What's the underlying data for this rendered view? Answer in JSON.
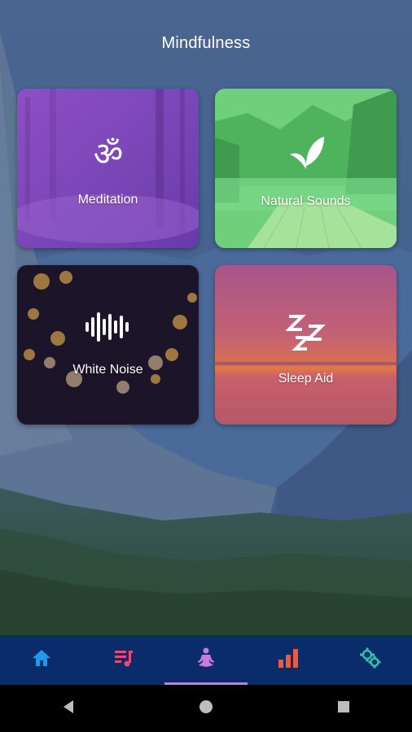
{
  "header": {
    "title": "Mindfulness"
  },
  "cards": {
    "meditation": {
      "label": "Meditation",
      "icon": "om-icon"
    },
    "natural": {
      "label": "Natural Sounds",
      "icon": "leaf-icon"
    },
    "noise": {
      "label": "White Noise",
      "icon": "sound-wave-icon"
    },
    "sleep": {
      "label": "Sleep Aid",
      "icon": "zzz-icon"
    }
  },
  "tabs": [
    {
      "name": "home",
      "icon": "home-icon",
      "color": "#1e9be8",
      "active": false
    },
    {
      "name": "playlist",
      "icon": "music-list-icon",
      "color": "#e84a7a",
      "active": false
    },
    {
      "name": "meditate",
      "icon": "meditation-person-icon",
      "color": "#c77ddb",
      "active": true
    },
    {
      "name": "stats",
      "icon": "bar-chart-icon",
      "color": "#ef5a3c",
      "active": false
    },
    {
      "name": "settings",
      "icon": "gears-icon",
      "color": "#2ec4a6",
      "active": false
    }
  ],
  "colors": {
    "tabbar": "#0a2c6a",
    "active_indicator": "#c77ddb"
  }
}
